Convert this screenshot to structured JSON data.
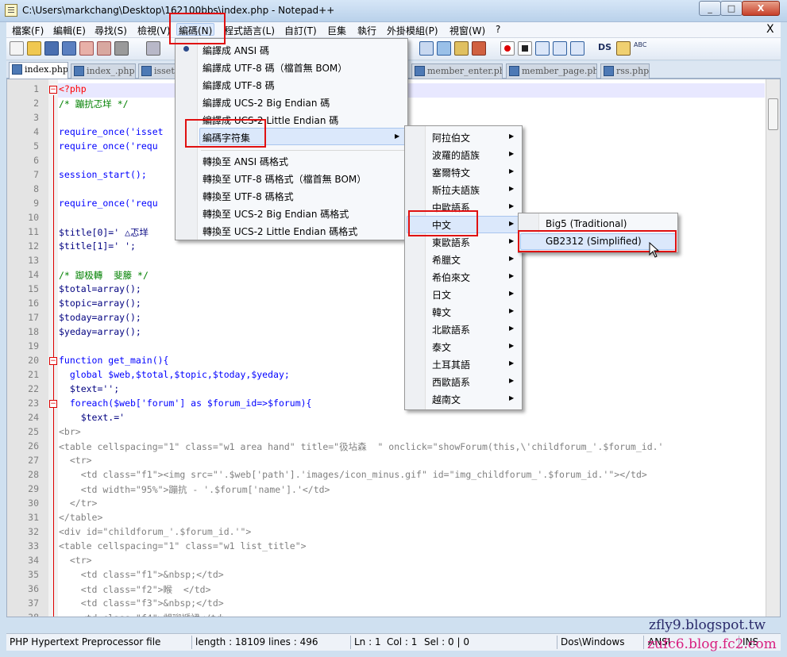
{
  "window": {
    "title": "C:\\Users\\markchang\\Desktop\\162100bbs\\index.php - Notepad++",
    "min": "_",
    "max": "□",
    "close": "X"
  },
  "menubar": {
    "items": [
      "檔案(F)",
      "編輯(E)",
      "尋找(S)",
      "檢視(V)",
      "編碼(N)",
      "程式語言(L)",
      "自訂(T)",
      "巨集",
      "執行",
      "外掛模組(P)",
      "視窗(W)",
      "?"
    ],
    "close_x": "X"
  },
  "toolbar": {
    "spell_label": "DS",
    "abc_label": "ABC"
  },
  "tabs": [
    "index.php",
    "index_.php",
    "isset.p",
    "member_enter.php",
    "member_page.php",
    "rss.php"
  ],
  "editor": {
    "line_numbers": [
      "1",
      "2",
      "3",
      "4",
      "5",
      "6",
      "7",
      "8",
      "9",
      "10",
      "11",
      "12",
      "13",
      "14",
      "15",
      "16",
      "17",
      "18",
      "19",
      "20",
      "21",
      "22",
      "23",
      "24",
      "25",
      "26",
      "27",
      "28",
      "29",
      "30",
      "31",
      "32",
      "33",
      "34",
      "35",
      "36",
      "37",
      "38"
    ],
    "lines": [
      "<?php",
      "/* 蹦抗忑垟 */",
      "",
      "require_once('isset",
      "require_once('requ",
      "",
      "session_start();",
      "",
      "require_once('requ",
      "",
      "$title[0]=' △忑垟",
      "$title[1]=' ';",
      "",
      "/* 踋极轉  斐籐 */",
      "$total=array();",
      "$topic=array();",
      "$today=array();",
      "$yeday=array();",
      "",
      "function get_main(){",
      "  global $web,$total,$topic,$today,$yeday;",
      "  $text='';",
      "  foreach($web['forum'] as $forum_id=>$forum){",
      "    $text.='",
      "<br>",
      "<table cellspacing=\"1\" class=\"w1 area hand\" title=\"彶坫森  \" onclick=\"showForum(this,\\'childforum_'.$forum_id.'",
      "  <tr>",
      "    <td class=\"f1\"><img src=\"'.$web['path'].'images/icon_minus.gif\" id=\"img_childforum_'.$forum_id.'\"></td>",
      "    <td width=\"95%\">蹦抗 - '.$forum['name'].'</td>",
      "  </tr>",
      "</table>",
      "<div id=\"childforum_'.$forum_id.'\">",
      "<table cellspacing=\"1\" class=\"w1 list_title\">",
      "  <tr>",
      "    <td class=\"f1\">&nbsp;</td>",
      "    <td class=\"f2\">睺  </td>",
      "    <td class=\"f3\">&nbsp;</td>",
      "    <td class=\"f4\">覜珋褫裙</td>"
    ]
  },
  "encoding_menu": {
    "items": [
      "編譯成 ANSI 碼",
      "編譯成 UTF-8 碼（檔首無 BOM）",
      "編譯成 UTF-8 碼",
      "編譯成 UCS-2 Big Endian 碼",
      "編譯成 UCS-2 Little Endian 碼",
      "編碼字符集",
      "轉換至 ANSI 碼格式",
      "轉換至 UTF-8 碼格式（檔首無 BOM）",
      "轉換至 UTF-8 碼格式",
      "轉換至 UCS-2 Big Endian 碼格式",
      "轉換至 UCS-2 Little Endian 碼格式"
    ]
  },
  "charset_menu": {
    "items": [
      "阿拉伯文",
      "波羅的語族",
      "塞爾特文",
      "斯拉夫語族",
      "中歐語系",
      "中文",
      "東歐語系",
      "希臘文",
      "希伯來文",
      "日文",
      "韓文",
      "北歐語系",
      "泰文",
      "土耳其語",
      "西歐語系",
      "越南文"
    ]
  },
  "chinese_menu": {
    "items": [
      "Big5 (Traditional)",
      "GB2312 (Simplified)"
    ]
  },
  "statusbar": {
    "filetype": "PHP Hypertext Preprocessor file",
    "length": "length : 18109",
    "lines": "lines : 496",
    "ln": "Ln : 1",
    "col": "Col : 1",
    "sel": "Sel : 0 | 0",
    "eol": "Dos\\Windows",
    "encoding": "ANSI",
    "ins": "INS"
  },
  "watermark": {
    "line1": "zfly9.blogspot.tw",
    "line2": "zufc6.blog.fc2.com"
  },
  "colors": {
    "highlight_box": "#e01010",
    "keyword": "#0000ff",
    "comment": "#008000",
    "string": "#808080",
    "variable": "#000080"
  }
}
